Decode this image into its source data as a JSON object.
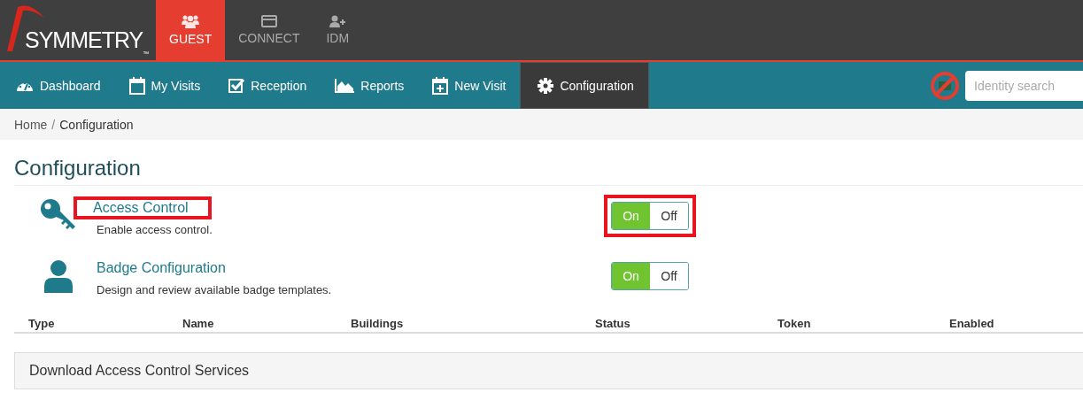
{
  "brand": {
    "logo": "SYMMETRY",
    "trademark": "™"
  },
  "products": [
    {
      "label": "GUEST",
      "selected": true
    },
    {
      "label": "CONNECT",
      "selected": false
    },
    {
      "label": "IDM",
      "selected": false
    }
  ],
  "nav": [
    {
      "label": "Dashboard",
      "selected": false
    },
    {
      "label": "My Visits",
      "selected": false
    },
    {
      "label": "Reception",
      "selected": false
    },
    {
      "label": "Reports",
      "selected": false
    },
    {
      "label": "New Visit",
      "selected": false
    },
    {
      "label": "Configuration",
      "selected": true
    }
  ],
  "search": {
    "placeholder": "Identity search"
  },
  "breadcrumb": {
    "items": [
      "Home",
      "Configuration"
    ],
    "separator": "/"
  },
  "page_title": "Configuration",
  "features": [
    {
      "title": "Access Control",
      "description": "Enable access control.",
      "highlighted": true,
      "toggle": {
        "on_label": "On",
        "off_label": "Off",
        "on": true,
        "highlighted": true
      }
    },
    {
      "title": "Badge Configuration",
      "description": "Design and review available badge templates.",
      "highlighted": false,
      "toggle": {
        "on_label": "On",
        "off_label": "Off",
        "on": true,
        "highlighted": false
      }
    }
  ],
  "table": {
    "columns": [
      "Type",
      "Name",
      "Buildings",
      "Status",
      "Token",
      "Enabled"
    ]
  },
  "panel": {
    "title": "Download Access Control Services"
  }
}
